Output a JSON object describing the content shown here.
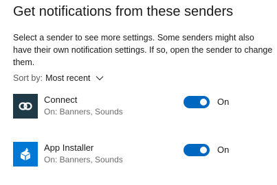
{
  "page": {
    "title": "Get notifications from these senders",
    "description": "Select a sender to see more settings. Some senders might also have their own notification settings. If so, open the sender to change them."
  },
  "sort": {
    "label": "Sort by:",
    "value": "Most recent",
    "icon": "chevron-down-icon"
  },
  "colors": {
    "accent": "#0067c0",
    "connect_tile": "#1f3a47",
    "installer_tile": "#0078d4"
  },
  "senders": [
    {
      "name": "Connect",
      "status": "On: Banners, Sounds",
      "toggle_on": true,
      "toggle_label": "On",
      "icon": "connect-icon"
    },
    {
      "name": "App Installer",
      "status": "On: Banners, Sounds",
      "toggle_on": true,
      "toggle_label": "On",
      "icon": "app-installer-icon"
    }
  ]
}
